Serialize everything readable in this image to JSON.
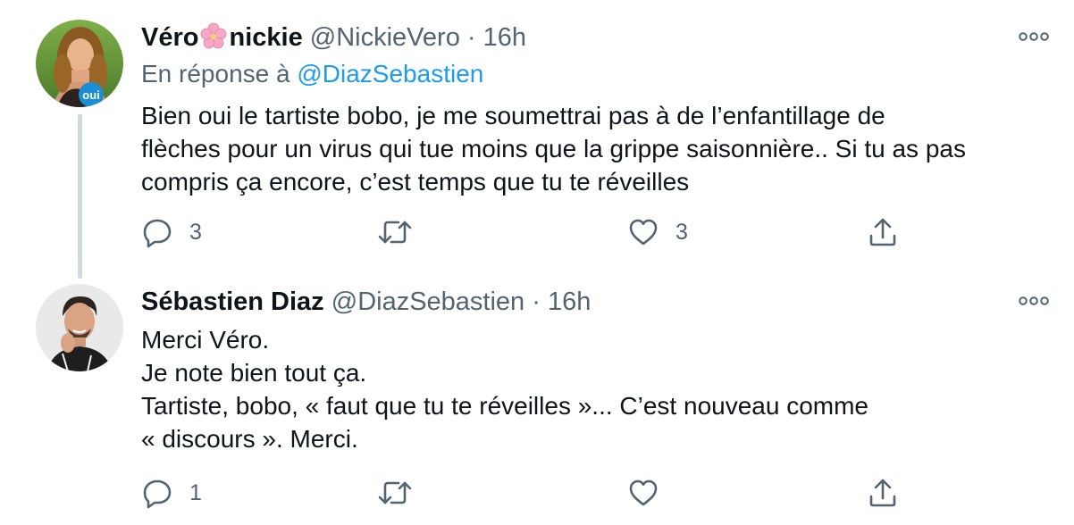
{
  "tweets": [
    {
      "author": {
        "name_part1": "Véro",
        "name_part2": "nickie",
        "handle": "@NickieVero",
        "time": "16h"
      },
      "avatar_badge": "oui",
      "reply_prefix": "En réponse à",
      "reply_handle": "@DiazSebastien",
      "text_lines": [
        "Bien oui le tartiste bobo, je me soumettrai pas à de l’enfantillage de",
        "flèches pour un virus qui tue moins que la grippe saisonnière.. Si tu as pas",
        "compris ça encore, c’est temps que tu te réveilles"
      ],
      "replies": "3",
      "retweets": "",
      "likes": "3"
    },
    {
      "author": {
        "name": "Sébastien Diaz",
        "handle": "@DiazSebastien",
        "time": "16h"
      },
      "text_lines": [
        "Merci Véro.",
        "Je note bien tout ça.",
        "Tartiste, bobo, « faut que tu te réveilles »... C’est nouveau comme",
        "« discours ». Merci."
      ],
      "replies": "1",
      "retweets": "",
      "likes": ""
    }
  ],
  "separator": "·",
  "icons": {
    "reply": "reply-icon",
    "retweet": "retweet-icon",
    "like": "heart-icon",
    "share": "share-icon",
    "more": "more-icon",
    "blossom": "cherry-blossom-icon"
  },
  "colors": {
    "link": "#1d9bf0",
    "muted": "#536471",
    "text": "#0f1419",
    "thread_line": "#cfd9de"
  }
}
